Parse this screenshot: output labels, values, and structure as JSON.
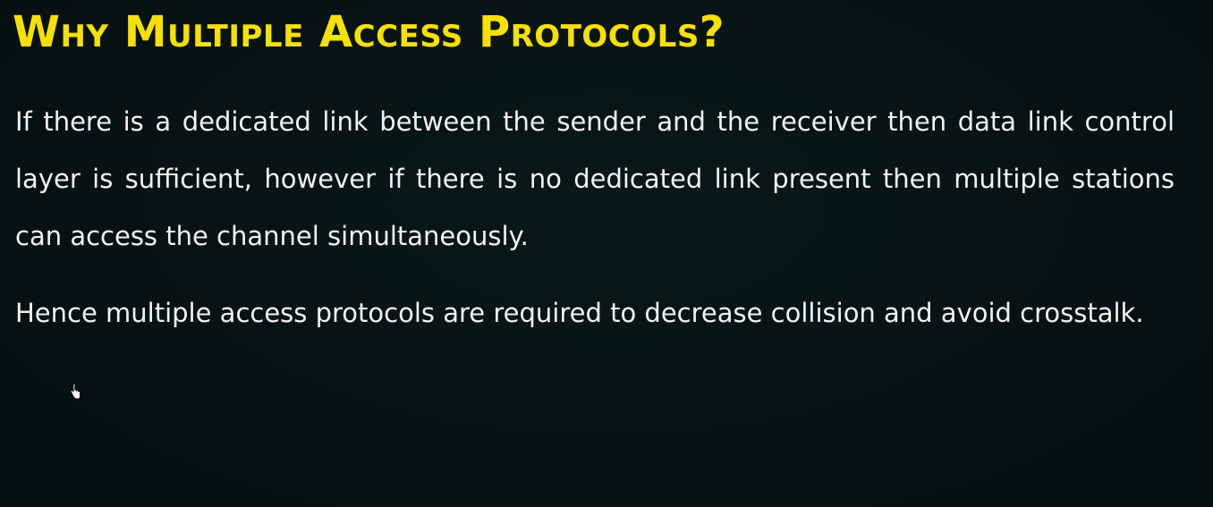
{
  "slide": {
    "title": "Why Multiple Access Protocols?",
    "paragraphs": [
      "If there is a dedicated link between the sender and the receiver then data link control layer is sufficient, however if there is no dedicated link present then multiple stations can access the channel simultaneously.",
      "Hence multiple access protocols are required to decrease collision and avoid crosstalk."
    ]
  },
  "colors": {
    "background": "#071415",
    "title": "#f6e000",
    "body_text": "#f2f2f2"
  },
  "icons": {
    "cursor": "hand-pointer-icon"
  }
}
